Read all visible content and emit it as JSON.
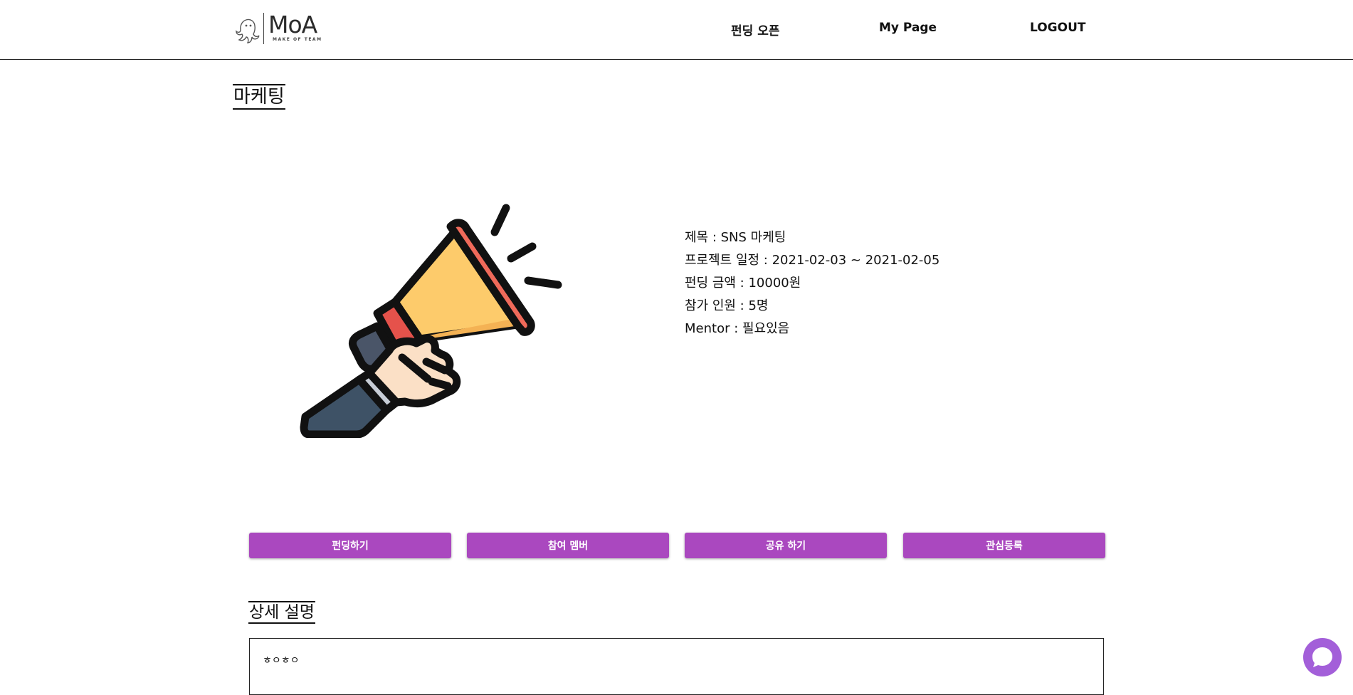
{
  "header": {
    "logo_text": "MoA",
    "logo_sub": "MAKE OF TEAM",
    "nav": [
      {
        "label": "펀딩 오픈"
      },
      {
        "label": "My Page"
      },
      {
        "label": "LOGOUT"
      }
    ]
  },
  "category_title": "마케팅",
  "project": {
    "title_row": "제목 : SNS 마케팅",
    "schedule_row": "프로젝트 일정 : 2021-02-03 ~ 2021-02-05",
    "amount_row": "펀딩 금액 : 10000원",
    "participants_row": "참가 인원 : 5명",
    "mentor_row": "Mentor : 필요있음"
  },
  "actions": [
    {
      "label": "펀딩하기"
    },
    {
      "label": "참여 멤버"
    },
    {
      "label": "공유 하기"
    },
    {
      "label": "관심등록"
    }
  ],
  "detail": {
    "heading": "상세 설명",
    "text": "ㅎㅇㅎㅇ"
  },
  "icons": {
    "logo": "ghost-octopus-logo",
    "illustration": "megaphone-hand-illustration",
    "chat": "chat-bubble-icon"
  },
  "colors": {
    "accent": "#aa48bf",
    "chat": "#a35fd9"
  }
}
